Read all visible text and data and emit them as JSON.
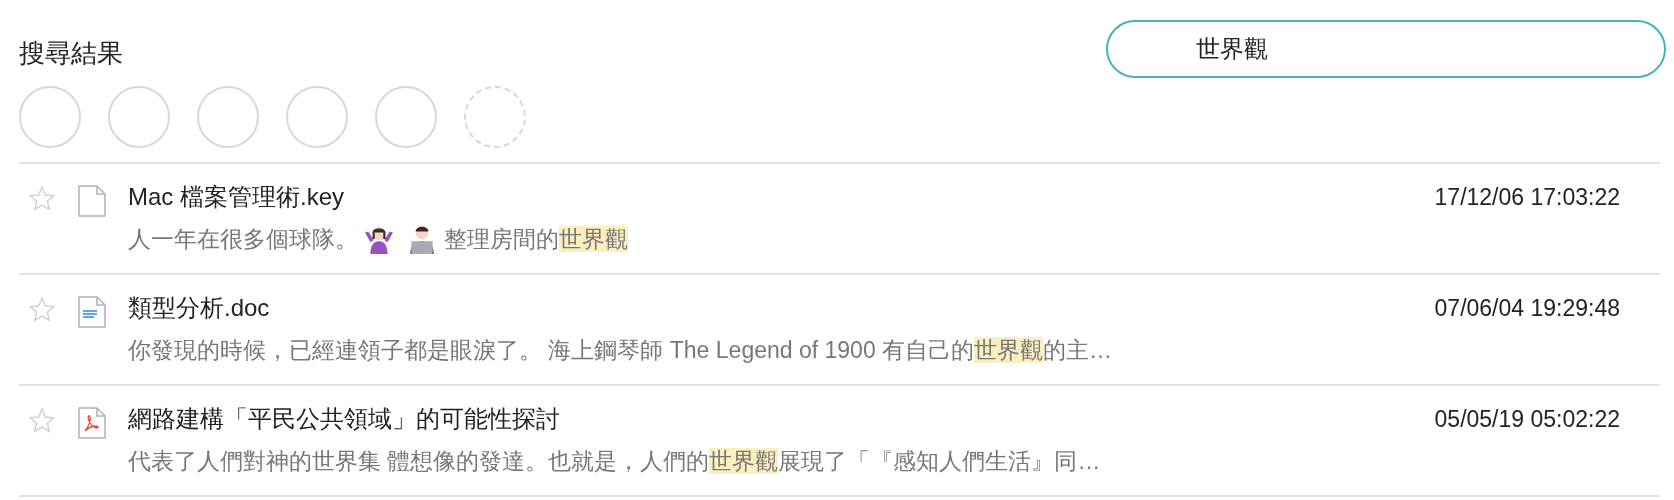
{
  "title": "搜尋結果",
  "search": {
    "value": "世界觀"
  },
  "placeholders": [
    {
      "loading": false
    },
    {
      "loading": false
    },
    {
      "loading": false
    },
    {
      "loading": false
    },
    {
      "loading": false
    },
    {
      "loading": true
    }
  ],
  "results": [
    {
      "starred": false,
      "kind": "blank",
      "name": "Mac 檔案管理術.key",
      "date": "17/12/06 17:03:22",
      "snippet": [
        {
          "kind": "text",
          "text": "人一年在很多個球隊。",
          "highlight": false
        },
        {
          "kind": "shrug"
        },
        {
          "kind": "coder"
        },
        {
          "kind": "text",
          "text": "整理房間的",
          "highlight": false
        },
        {
          "kind": "text",
          "text": "世界觀",
          "highlight": true
        }
      ]
    },
    {
      "starred": false,
      "kind": "doc",
      "name": "類型分析.doc",
      "date": "07/06/04 19:29:48",
      "snippet": [
        {
          "kind": "text",
          "text": "你發現的時候，已經連領子都是眼淚了。 海上鋼琴師 The Legend of 1900 有自己的",
          "highlight": false
        },
        {
          "kind": "text",
          "text": "世界觀",
          "highlight": true
        },
        {
          "kind": "text",
          "text": "的主…",
          "highlight": false
        }
      ]
    },
    {
      "starred": false,
      "kind": "pdf",
      "name": "網路建構「平民公共領域」的可能性探討",
      "date": "05/05/19 05:02:22",
      "snippet": [
        {
          "kind": "text",
          "text": "代表了人們對神的世界集 體想像的發達。也就是，人們的",
          "highlight": false
        },
        {
          "kind": "text",
          "text": "世界觀",
          "highlight": true
        },
        {
          "kind": "text",
          "text": "展現了「『感知人們生活』同…",
          "highlight": false
        }
      ]
    }
  ]
}
